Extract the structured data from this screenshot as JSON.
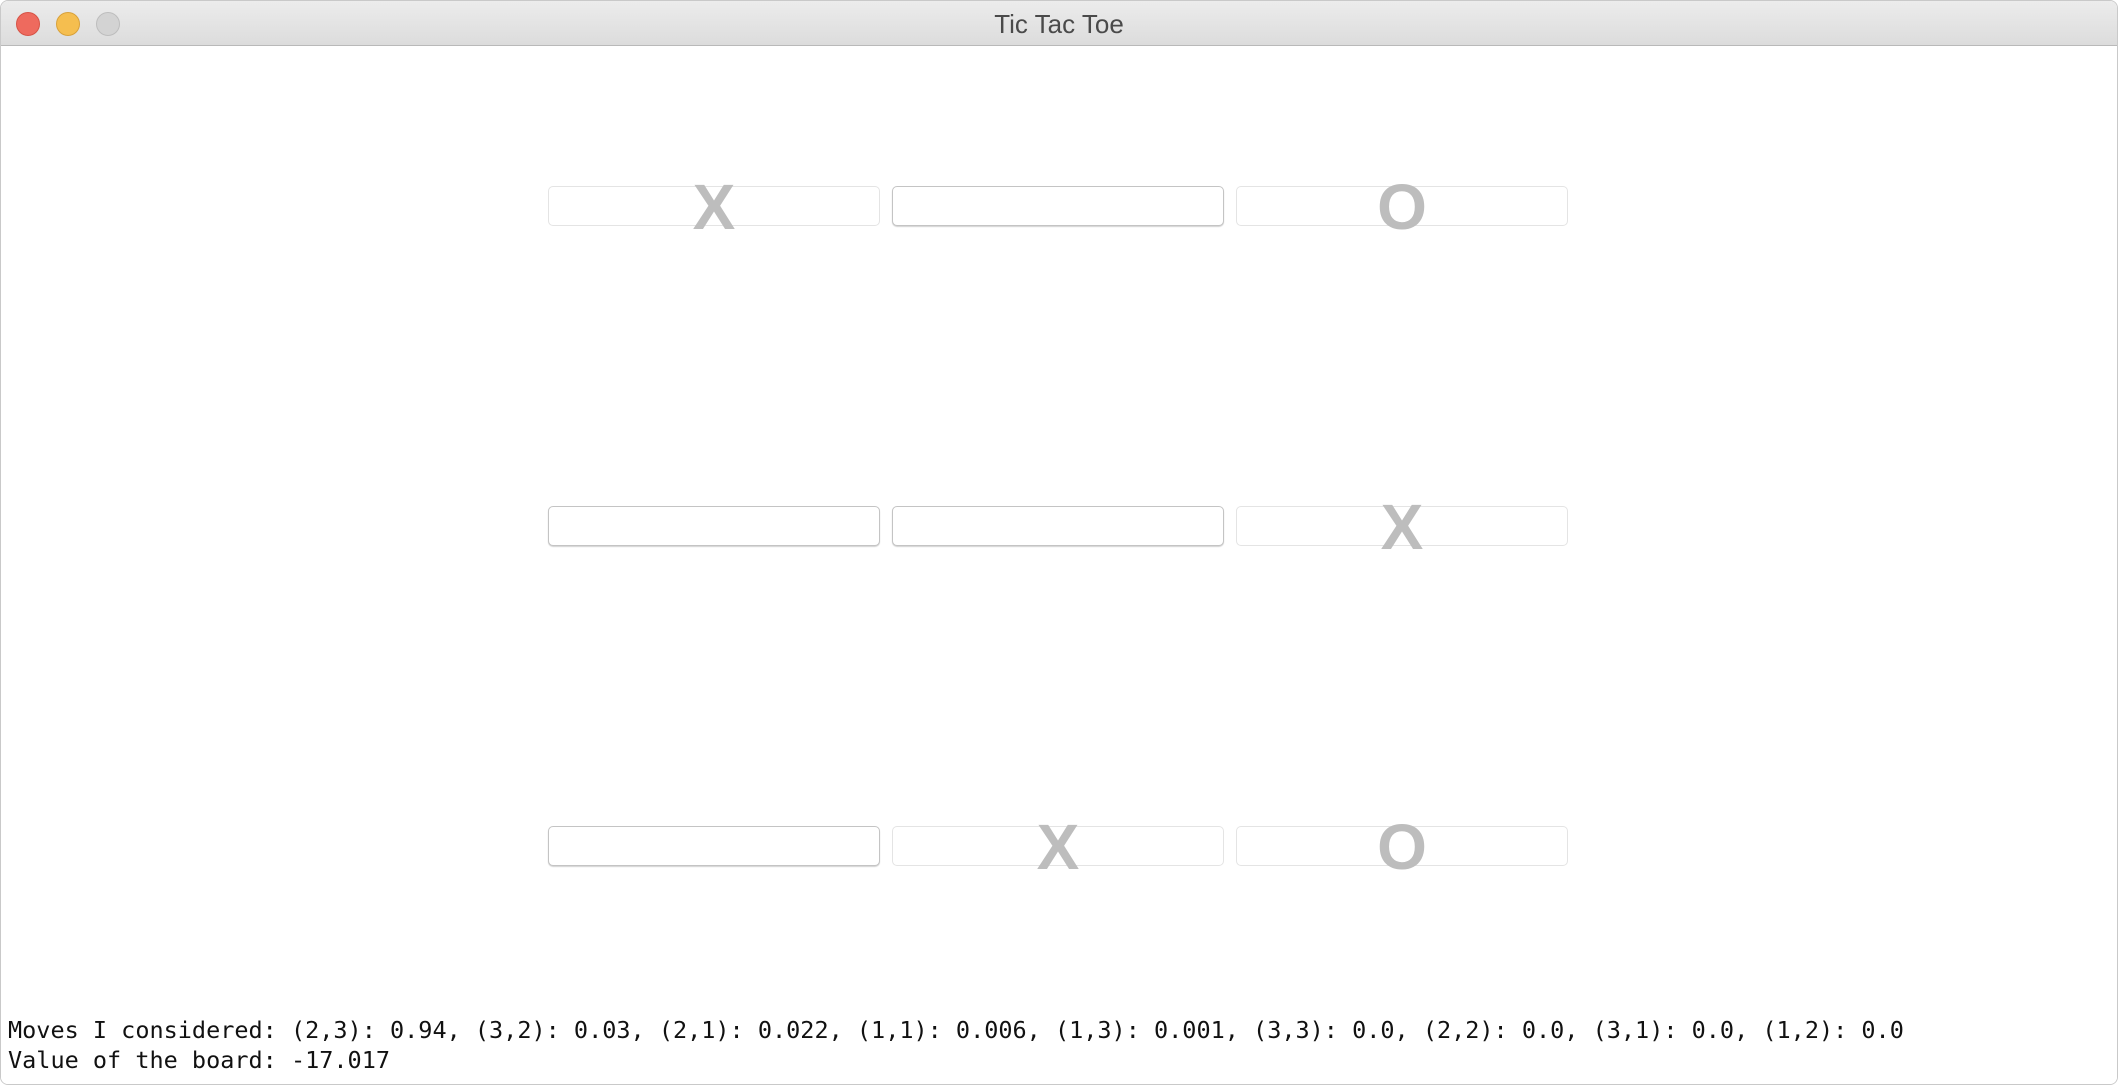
{
  "window": {
    "title": "Tic Tac Toe"
  },
  "board": {
    "rows": [
      [
        "X",
        "",
        "O"
      ],
      [
        "",
        "",
        "X"
      ],
      [
        "",
        "X",
        "O"
      ]
    ]
  },
  "status": {
    "moves_line": "Moves I considered: (2,3): 0.94, (3,2): 0.03, (2,1): 0.022, (1,1): 0.006, (1,3): 0.001, (3,3): 0.0, (2,2): 0.0, (3,1): 0.0, (1,2): 0.0",
    "value_line": "Value of the board: -17.017"
  }
}
